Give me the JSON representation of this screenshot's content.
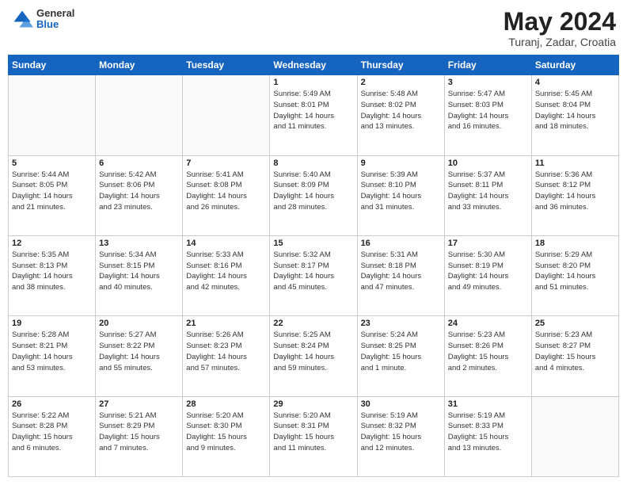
{
  "header": {
    "logo_general": "General",
    "logo_blue": "Blue",
    "title": "May 2024",
    "subtitle": "Turanj, Zadar, Croatia"
  },
  "days_of_week": [
    "Sunday",
    "Monday",
    "Tuesday",
    "Wednesday",
    "Thursday",
    "Friday",
    "Saturday"
  ],
  "weeks": [
    [
      {
        "day": "",
        "info": ""
      },
      {
        "day": "",
        "info": ""
      },
      {
        "day": "",
        "info": ""
      },
      {
        "day": "1",
        "info": "Sunrise: 5:49 AM\nSunset: 8:01 PM\nDaylight: 14 hours\nand 11 minutes."
      },
      {
        "day": "2",
        "info": "Sunrise: 5:48 AM\nSunset: 8:02 PM\nDaylight: 14 hours\nand 13 minutes."
      },
      {
        "day": "3",
        "info": "Sunrise: 5:47 AM\nSunset: 8:03 PM\nDaylight: 14 hours\nand 16 minutes."
      },
      {
        "day": "4",
        "info": "Sunrise: 5:45 AM\nSunset: 8:04 PM\nDaylight: 14 hours\nand 18 minutes."
      }
    ],
    [
      {
        "day": "5",
        "info": "Sunrise: 5:44 AM\nSunset: 8:05 PM\nDaylight: 14 hours\nand 21 minutes."
      },
      {
        "day": "6",
        "info": "Sunrise: 5:42 AM\nSunset: 8:06 PM\nDaylight: 14 hours\nand 23 minutes."
      },
      {
        "day": "7",
        "info": "Sunrise: 5:41 AM\nSunset: 8:08 PM\nDaylight: 14 hours\nand 26 minutes."
      },
      {
        "day": "8",
        "info": "Sunrise: 5:40 AM\nSunset: 8:09 PM\nDaylight: 14 hours\nand 28 minutes."
      },
      {
        "day": "9",
        "info": "Sunrise: 5:39 AM\nSunset: 8:10 PM\nDaylight: 14 hours\nand 31 minutes."
      },
      {
        "day": "10",
        "info": "Sunrise: 5:37 AM\nSunset: 8:11 PM\nDaylight: 14 hours\nand 33 minutes."
      },
      {
        "day": "11",
        "info": "Sunrise: 5:36 AM\nSunset: 8:12 PM\nDaylight: 14 hours\nand 36 minutes."
      }
    ],
    [
      {
        "day": "12",
        "info": "Sunrise: 5:35 AM\nSunset: 8:13 PM\nDaylight: 14 hours\nand 38 minutes."
      },
      {
        "day": "13",
        "info": "Sunrise: 5:34 AM\nSunset: 8:15 PM\nDaylight: 14 hours\nand 40 minutes."
      },
      {
        "day": "14",
        "info": "Sunrise: 5:33 AM\nSunset: 8:16 PM\nDaylight: 14 hours\nand 42 minutes."
      },
      {
        "day": "15",
        "info": "Sunrise: 5:32 AM\nSunset: 8:17 PM\nDaylight: 14 hours\nand 45 minutes."
      },
      {
        "day": "16",
        "info": "Sunrise: 5:31 AM\nSunset: 8:18 PM\nDaylight: 14 hours\nand 47 minutes."
      },
      {
        "day": "17",
        "info": "Sunrise: 5:30 AM\nSunset: 8:19 PM\nDaylight: 14 hours\nand 49 minutes."
      },
      {
        "day": "18",
        "info": "Sunrise: 5:29 AM\nSunset: 8:20 PM\nDaylight: 14 hours\nand 51 minutes."
      }
    ],
    [
      {
        "day": "19",
        "info": "Sunrise: 5:28 AM\nSunset: 8:21 PM\nDaylight: 14 hours\nand 53 minutes."
      },
      {
        "day": "20",
        "info": "Sunrise: 5:27 AM\nSunset: 8:22 PM\nDaylight: 14 hours\nand 55 minutes."
      },
      {
        "day": "21",
        "info": "Sunrise: 5:26 AM\nSunset: 8:23 PM\nDaylight: 14 hours\nand 57 minutes."
      },
      {
        "day": "22",
        "info": "Sunrise: 5:25 AM\nSunset: 8:24 PM\nDaylight: 14 hours\nand 59 minutes."
      },
      {
        "day": "23",
        "info": "Sunrise: 5:24 AM\nSunset: 8:25 PM\nDaylight: 15 hours\nand 1 minute."
      },
      {
        "day": "24",
        "info": "Sunrise: 5:23 AM\nSunset: 8:26 PM\nDaylight: 15 hours\nand 2 minutes."
      },
      {
        "day": "25",
        "info": "Sunrise: 5:23 AM\nSunset: 8:27 PM\nDaylight: 15 hours\nand 4 minutes."
      }
    ],
    [
      {
        "day": "26",
        "info": "Sunrise: 5:22 AM\nSunset: 8:28 PM\nDaylight: 15 hours\nand 6 minutes."
      },
      {
        "day": "27",
        "info": "Sunrise: 5:21 AM\nSunset: 8:29 PM\nDaylight: 15 hours\nand 7 minutes."
      },
      {
        "day": "28",
        "info": "Sunrise: 5:20 AM\nSunset: 8:30 PM\nDaylight: 15 hours\nand 9 minutes."
      },
      {
        "day": "29",
        "info": "Sunrise: 5:20 AM\nSunset: 8:31 PM\nDaylight: 15 hours\nand 11 minutes."
      },
      {
        "day": "30",
        "info": "Sunrise: 5:19 AM\nSunset: 8:32 PM\nDaylight: 15 hours\nand 12 minutes."
      },
      {
        "day": "31",
        "info": "Sunrise: 5:19 AM\nSunset: 8:33 PM\nDaylight: 15 hours\nand 13 minutes."
      },
      {
        "day": "",
        "info": ""
      }
    ]
  ]
}
